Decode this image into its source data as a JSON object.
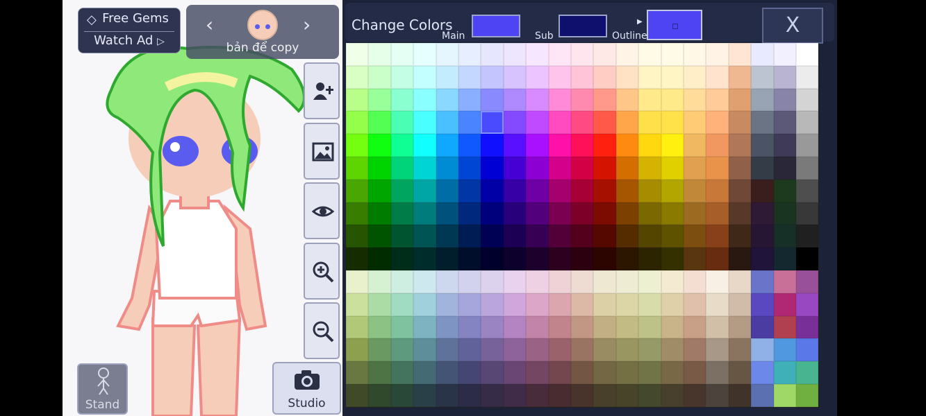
{
  "game": {
    "gems_label": "Free Gems",
    "watch_ad_label": "Watch Ad",
    "character_name": "bản để copy",
    "stand_label": "Stand",
    "studio_label": "Studio"
  },
  "color_panel": {
    "title": "Change Colors",
    "main_label": "Main",
    "sub_label": "Sub",
    "outline_label": "Outline",
    "close_label": "X",
    "main_color": "#4e44f3",
    "sub_color": "#0f0f6e",
    "outline_color": "#4e44f3",
    "selected_cell": {
      "row": 3,
      "col": 6
    }
  },
  "palette": {
    "columns": 21,
    "rows": 16,
    "colors": [
      [
        "#f0ffe8",
        "#e6ffe8",
        "#e6fff4",
        "#e6ffff",
        "#e6f6ff",
        "#e6eeff",
        "#e6e6ff",
        "#eee6ff",
        "#f7e6ff",
        "#ffe6f7",
        "#ffe6ee",
        "#ffe9e6",
        "#fff4e6",
        "#fffbe6",
        "#fffbe6",
        "#fff8e6",
        "#fff3e6",
        "#ffe6d4",
        "#e8eaff",
        "#f2efff",
        "#ffffff"
      ],
      [
        "#d9ffc4",
        "#caffca",
        "#c4ffe5",
        "#c4ffff",
        "#c4ecff",
        "#c4d7ff",
        "#c4c4ff",
        "#d7c4ff",
        "#ecc4ff",
        "#ffc4ec",
        "#ffc4d7",
        "#ffcdc4",
        "#ffe2c4",
        "#fff4c4",
        "#fff5c4",
        "#ffeec8",
        "#ffe3cc",
        "#f0b890",
        "#bcc4d2",
        "#b8b4d2",
        "#ececec"
      ],
      [
        "#b8ff8a",
        "#99ff99",
        "#8affcf",
        "#8affff",
        "#8ad8ff",
        "#8aafff",
        "#8a8aff",
        "#af8aff",
        "#d88aff",
        "#ff8ad8",
        "#ff8aaf",
        "#ff998a",
        "#ffc68a",
        "#ffe98a",
        "#ffea8a",
        "#ffdc99",
        "#ffcc99",
        "#e0a070",
        "#98a4b4",
        "#8884a8",
        "#d4d4d4"
      ],
      [
        "#94ff4a",
        "#52ff52",
        "#4affb4",
        "#4affff",
        "#4ac0ff",
        "#4a84ff",
        "#4a4aff",
        "#844aff",
        "#c04aff",
        "#ff4ac0",
        "#ff4a84",
        "#ff594a",
        "#ffa64a",
        "#ffe04a",
        "#ffe24a",
        "#ffcb75",
        "#ffb27a",
        "#c88a60",
        "#6a7484",
        "#5c5878",
        "#b8b8b8"
      ],
      [
        "#74ff10",
        "#10ff10",
        "#10ff94",
        "#10ffff",
        "#10a8ff",
        "#1058ff",
        "#1010ff",
        "#5810ff",
        "#a810ff",
        "#ff10a8",
        "#ff1058",
        "#ff2010",
        "#ff8a10",
        "#ffd810",
        "#fff010",
        "#f0b860",
        "#f09860",
        "#b07858",
        "#4a5464",
        "#3e3a58",
        "#999999"
      ],
      [
        "#5ed400",
        "#00d400",
        "#00d47a",
        "#00d4d4",
        "#008cd4",
        "#0046d4",
        "#0000d4",
        "#4600d4",
        "#8c00d4",
        "#d4008c",
        "#d40046",
        "#d41400",
        "#d46e00",
        "#d4b400",
        "#e0d000",
        "#e0a050",
        "#e8924a",
        "#906048",
        "#343c48",
        "#2a2838",
        "#7a7a7a"
      ],
      [
        "#4aa600",
        "#00a600",
        "#00a660",
        "#00a6a6",
        "#006ea6",
        "#0036a6",
        "#0000a6",
        "#3600a6",
        "#6e00a6",
        "#a6006e",
        "#a60036",
        "#a61000",
        "#a65600",
        "#a68c00",
        "#b4a600",
        "#c08838",
        "#c87838",
        "#704838",
        "#3a1e1e",
        "#1e3a1e",
        "#4e4e4e"
      ],
      [
        "#387c00",
        "#007c00",
        "#007c48",
        "#007c7c",
        "#00527c",
        "#00287c",
        "#00007c",
        "#28007c",
        "#52007c",
        "#7c0052",
        "#7c0028",
        "#7c0c00",
        "#7c4000",
        "#7c6800",
        "#8a7a00",
        "#9c6a20",
        "#a85e28",
        "#583828",
        "#2e1a34",
        "#1a3422",
        "#383838"
      ],
      [
        "#265400",
        "#005400",
        "#005430",
        "#005454",
        "#003854",
        "#001c54",
        "#000054",
        "#1c0054",
        "#380054",
        "#540038",
        "#54001c",
        "#540800",
        "#542c00",
        "#544600",
        "#5e5200",
        "#7c4e10",
        "#884018",
        "#402818",
        "#261634",
        "#163028",
        "#202020"
      ],
      [
        "#142c00",
        "#002c00",
        "#002c1a",
        "#002c2c",
        "#001e2c",
        "#000e2c",
        "#00002c",
        "#0e002c",
        "#1e002c",
        "#2c001e",
        "#2c000e",
        "#2c0400",
        "#2c1600",
        "#2c2400",
        "#343000",
        "#5a3610",
        "#682c10",
        "#281810",
        "#20143a",
        "#142830",
        "#000000"
      ],
      [
        "#e8f0cc",
        "#d6f0d2",
        "#cdeee0",
        "#cde8ee",
        "#cdd8ee",
        "#d2d2ee",
        "#dcd2ee",
        "#e8d2ee",
        "#eed2e4",
        "#eed2d6",
        "#eedcd2",
        "#eee8d2",
        "#eeecd2",
        "#eef0d2",
        "#f4ead2",
        "#f4ded2",
        "#f8f0e4",
        "#e8d8c8",
        "#6a74c8",
        "#c87098",
        "#985098"
      ],
      [
        "#cce09e",
        "#acdca6",
        "#a0dcc2",
        "#a0d0dc",
        "#a0b4dc",
        "#a6a6dc",
        "#baa6dc",
        "#d0a6dc",
        "#dca6c8",
        "#dca6ae",
        "#dcb8a6",
        "#dcd0a6",
        "#dcd6a6",
        "#d8dcaa",
        "#e0d0aa",
        "#e0c0aa",
        "#e8dcc8",
        "#d0bca8",
        "#5a48c0",
        "#b02874",
        "#9848c0"
      ],
      [
        "#b0c878",
        "#8cc284",
        "#7ec2a0",
        "#7eb4c2",
        "#7e94c2",
        "#8484c2",
        "#9a84c2",
        "#b484c2",
        "#c284a8",
        "#c2848c",
        "#c29884",
        "#c2b084",
        "#c2bc84",
        "#bcc288",
        "#c8b488",
        "#c8a088",
        "#d0c0a8",
        "#b49c84",
        "#4a3ca0",
        "#b04050",
        "#783098"
      ],
      [
        "#8ca050",
        "#6a9a62",
        "#5e9a7e",
        "#5e8e9a",
        "#5e729a",
        "#62629a",
        "#78629a",
        "#8e629a",
        "#9a6284",
        "#9a626a",
        "#9a7462",
        "#9a8c62",
        "#9a9662",
        "#969a66",
        "#a08c66",
        "#a07a66",
        "#a89888",
        "#8a7460",
        "#90b0e8",
        "#5098e0",
        "#5a78e8"
      ],
      [
        "#687840",
        "#4e7446",
        "#44745c",
        "#446a74",
        "#445474",
        "#464674",
        "#584674",
        "#6a4674",
        "#744662",
        "#74464e",
        "#745644",
        "#746844",
        "#747044",
        "#707446",
        "#786846",
        "#785a46",
        "#7c7064",
        "#685644",
        "#6c88e8",
        "#40b0b8",
        "#48b490"
      ],
      [
        "#404a28",
        "#30482c",
        "#2a4838",
        "#2a4048",
        "#2a3448",
        "#2c2c48",
        "#362c48",
        "#402c48",
        "#482c3c",
        "#482c30",
        "#48342a",
        "#48402a",
        "#48442a",
        "#44482c",
        "#48402c",
        "#48362c",
        "#4c443c",
        "#40342a",
        "#5a70b0",
        "#a0d868",
        "#70b040"
      ]
    ]
  }
}
